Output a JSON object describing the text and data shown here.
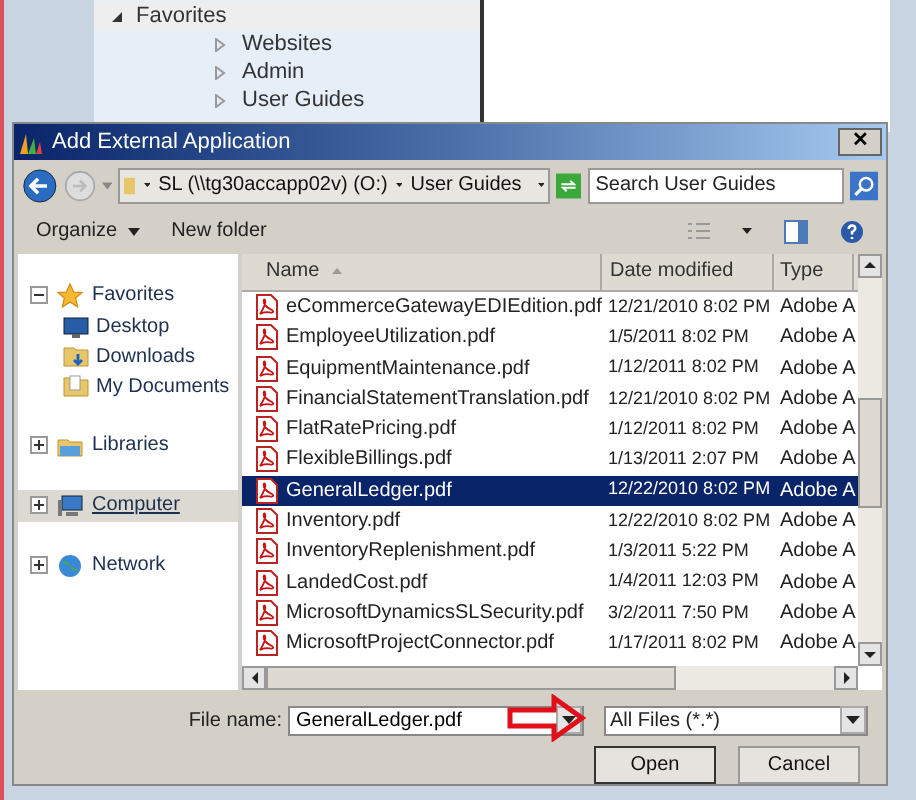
{
  "background_tree": {
    "root": {
      "label": "Favorites",
      "expanded": true
    },
    "items": [
      {
        "label": "Websites"
      },
      {
        "label": "Admin"
      },
      {
        "label": "User Guides"
      }
    ]
  },
  "dialog": {
    "title": "Add External Application",
    "close": "✕",
    "address": {
      "segments": [
        "SL (\\\\tg30accapp02v) (O:)",
        "User Guides"
      ]
    },
    "search": {
      "placeholder": "Search User Guides"
    },
    "toolbar": {
      "organize": "Organize",
      "new_folder": "New folder"
    },
    "nav": [
      {
        "label": "Favorites",
        "kind": "star",
        "expanded": true,
        "selected": false,
        "children": [
          {
            "label": "Desktop",
            "kind": "desktop",
            "selected": false
          },
          {
            "label": "Downloads",
            "kind": "downloads",
            "selected": false
          },
          {
            "label": "My Documents",
            "kind": "documents",
            "selected": false
          }
        ]
      },
      {
        "label": "Libraries",
        "kind": "libraries",
        "expanded": false,
        "selected": false
      },
      {
        "label": "Computer",
        "kind": "computer",
        "expanded": false,
        "selected": true
      },
      {
        "label": "Network",
        "kind": "network",
        "expanded": false,
        "selected": false
      }
    ],
    "columns": [
      "Name",
      "Date modified",
      "Type"
    ],
    "rows": [
      {
        "name": "eCommerceGatewayEDIEdition.pdf",
        "date": "12/21/2010 8:02 PM",
        "type": "Adobe A",
        "selected": false
      },
      {
        "name": "EmployeeUtilization.pdf",
        "date": "1/5/2011 8:02 PM",
        "type": "Adobe A",
        "selected": false
      },
      {
        "name": "EquipmentMaintenance.pdf",
        "date": "1/12/2011 8:02 PM",
        "type": "Adobe A",
        "selected": false
      },
      {
        "name": "FinancialStatementTranslation.pdf",
        "date": "12/21/2010 8:02 PM",
        "type": "Adobe A",
        "selected": false
      },
      {
        "name": "FlatRatePricing.pdf",
        "date": "1/12/2011 8:02 PM",
        "type": "Adobe A",
        "selected": false
      },
      {
        "name": "FlexibleBillings.pdf",
        "date": "1/13/2011 2:07 PM",
        "type": "Adobe A",
        "selected": false
      },
      {
        "name": "GeneralLedger.pdf",
        "date": "12/22/2010 8:02 PM",
        "type": "Adobe A",
        "selected": true
      },
      {
        "name": "Inventory.pdf",
        "date": "12/22/2010 8:02 PM",
        "type": "Adobe A",
        "selected": false
      },
      {
        "name": "InventoryReplenishment.pdf",
        "date": "1/3/2011 5:22 PM",
        "type": "Adobe A",
        "selected": false
      },
      {
        "name": "LandedCost.pdf",
        "date": "1/4/2011 12:03 PM",
        "type": "Adobe A",
        "selected": false
      },
      {
        "name": "MicrosoftDynamicsSLSecurity.pdf",
        "date": "3/2/2011 7:50 PM",
        "type": "Adobe A",
        "selected": false
      },
      {
        "name": "MicrosoftProjectConnector.pdf",
        "date": "1/17/2011 8:02 PM",
        "type": "Adobe A",
        "selected": false
      }
    ],
    "file_name": {
      "label": "File name:",
      "value": "GeneralLedger.pdf"
    },
    "file_type": {
      "value": "All Files (*.*)"
    },
    "buttons": [
      "Open",
      "Cancel"
    ]
  }
}
